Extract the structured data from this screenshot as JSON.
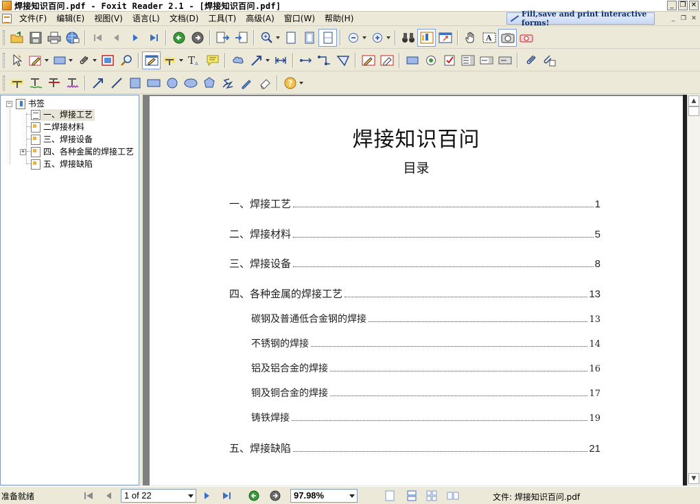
{
  "window": {
    "title": "焊接知识百问.pdf - Foxit Reader 2.1 - [焊接知识百问.pdf]",
    "buttons": [
      "_",
      "❐",
      "✕"
    ]
  },
  "menu": {
    "items": [
      "文件(F)",
      "编辑(E)",
      "视图(V)",
      "语言(L)",
      "文档(D)",
      "工具(T)",
      "高级(A)",
      "窗口(W)",
      "帮助(H)"
    ],
    "promo": "Fill,save and print interactive forms!",
    "mdi_buttons": [
      "_",
      "❐",
      "✕"
    ]
  },
  "colors": {
    "accent": "#3a6fc8",
    "green_nav": "#3a9a3a",
    "gray_nav": "#6a6a6a",
    "doc_bg": "#808080",
    "bookmark_icon": "#f2b233"
  },
  "bookmarks": {
    "root": "书签",
    "items": [
      {
        "label": "一、焊接工艺",
        "icon": "page-gray-icon",
        "selected": true
      },
      {
        "label": "二焊接材料",
        "icon": "page-bookmark-icon"
      },
      {
        "label": "三、焊接设备",
        "icon": "page-bookmark-icon"
      },
      {
        "label": "四、各种金属的焊接工艺",
        "icon": "page-bookmark-icon",
        "expandable": true
      },
      {
        "label": "五、焊接缺陷",
        "icon": "page-bookmark-icon"
      }
    ]
  },
  "document": {
    "title": "焊接知识百问",
    "toc_heading": "目录",
    "toc": [
      {
        "text": "一、焊接工艺",
        "page": "1",
        "level": 1
      },
      {
        "text": "二、焊接材料",
        "page": "5",
        "level": 1
      },
      {
        "text": "三、焊接设备",
        "page": "8",
        "level": 1
      },
      {
        "text": "四、各种金属的焊接工艺",
        "page": "13",
        "level": 1
      },
      {
        "text": "碳钢及普通低合金钢的焊接",
        "page": "13",
        "level": 2
      },
      {
        "text": "不锈钢的焊接",
        "page": "14",
        "level": 2
      },
      {
        "text": "铝及铝合金的焊接",
        "page": "16",
        "level": 2
      },
      {
        "text": "铜及铜合金的焊接",
        "page": "17",
        "level": 2
      },
      {
        "text": "铸铁焊接",
        "page": "19",
        "level": 2
      },
      {
        "text": "五、焊接缺陷",
        "page": "21",
        "level": 1
      }
    ]
  },
  "status": {
    "text": "准备就绪",
    "page": "1 of 22",
    "zoom": "97.98%",
    "file": "文件: 焊接知识百问.pdf"
  }
}
